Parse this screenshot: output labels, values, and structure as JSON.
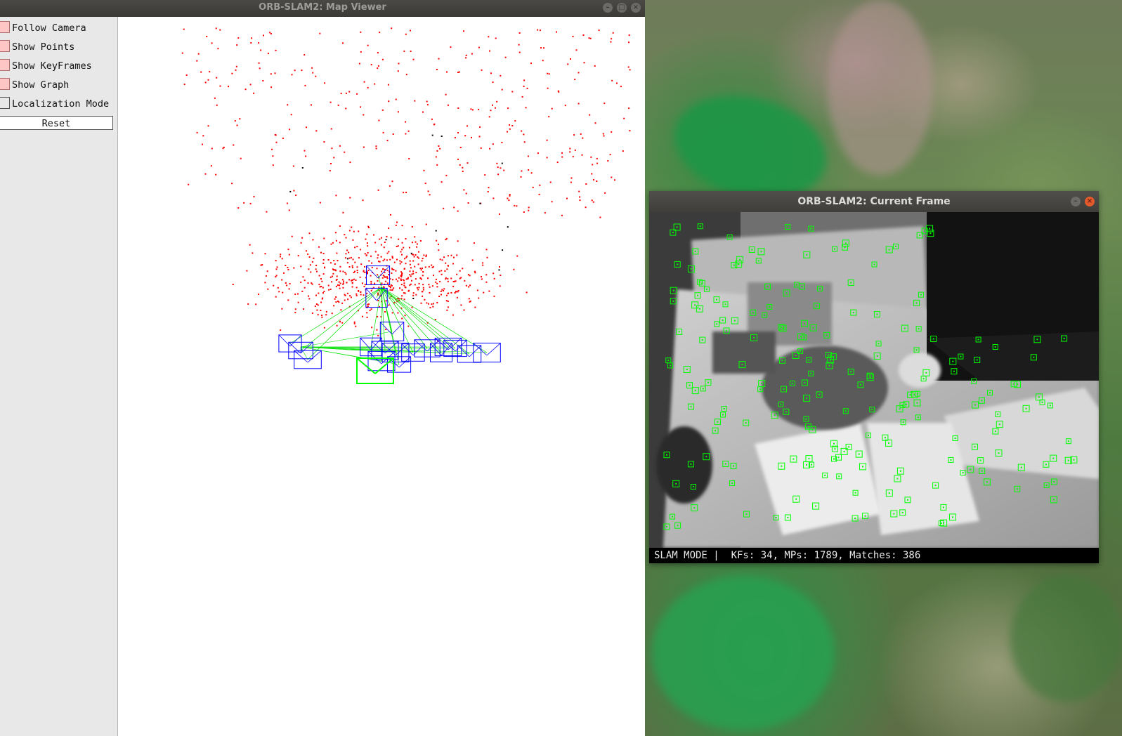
{
  "map_viewer": {
    "title": "ORB-SLAM2: Map Viewer",
    "options": [
      {
        "label": "Follow Camera",
        "checked": true
      },
      {
        "label": "Show Points",
        "checked": true
      },
      {
        "label": "Show KeyFrames",
        "checked": true
      },
      {
        "label": "Show Graph",
        "checked": true
      },
      {
        "label": "Localization Mode",
        "checked": false
      }
    ],
    "reset_label": "Reset"
  },
  "current_frame": {
    "title": "ORB-SLAM2: Current Frame",
    "mode": "SLAM MODE",
    "separator": "|",
    "keyframes": 34,
    "map_points": 1789,
    "matches": 386,
    "status_text": "SLAM MODE |  KFs: 34, MPs: 1789, Matches: 386"
  },
  "colors": {
    "map_point": "#ff0000",
    "reference_point": "#000000",
    "keyframe": "#0000ff",
    "graph_edge": "#00e000",
    "current_camera": "#00ff00",
    "feature_marker": "#00ff00",
    "checkbox_checked": "#ffc6c6"
  },
  "icons": {
    "window_minimize": "minimize-icon",
    "window_maximize": "maximize-icon",
    "window_close": "close-icon"
  }
}
